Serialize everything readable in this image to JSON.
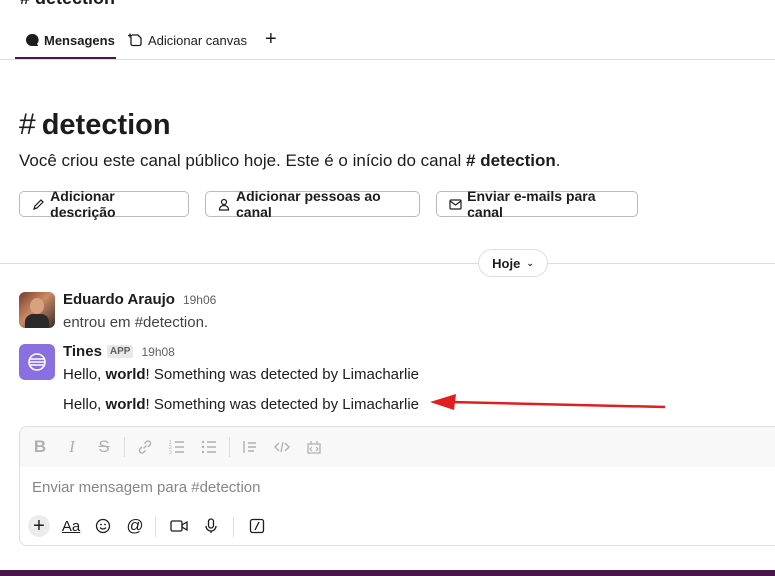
{
  "header": {
    "title": "# detection"
  },
  "tabs": [
    {
      "label": "Mensagens",
      "icon": "message-icon"
    },
    {
      "label": "Adicionar canvas",
      "icon": "canvas-add-icon"
    }
  ],
  "add_tab_icon": "plus-icon",
  "intro": {
    "hash": "#",
    "channel_name": "detection",
    "text_before": "Você criou este canal público hoje. Este é o início do canal ",
    "channel_bold": "# detection",
    "text_after": "."
  },
  "actions": [
    {
      "label": "Adicionar descrição",
      "icon": "pencil-icon"
    },
    {
      "label": "Adicionar pessoas ao canal",
      "icon": "person-add-icon"
    },
    {
      "label": "Enviar e-mails para canal",
      "icon": "email-icon"
    }
  ],
  "day_divider": {
    "label": "Hoje",
    "icon": "chevron-down-icon"
  },
  "messages": [
    {
      "author": "Eduardo Araujo",
      "time": "19h06",
      "text": "entrou em #detection."
    },
    {
      "author": "Tines",
      "badge": "APP",
      "time": "19h08",
      "lines": [
        {
          "before": "Hello, ",
          "bold": "world",
          "after": "! Something was detected by Limacharlie"
        },
        {
          "before": "Hello, ",
          "bold": "world",
          "after": "! Something was detected by Limacharlie"
        }
      ]
    }
  ],
  "annotation": {
    "color": "#e01e1e"
  },
  "composer": {
    "placeholder": "Enviar mensagem para #detection",
    "format_icons": [
      "bold-icon",
      "italic-icon",
      "strikethrough-icon",
      "link-icon",
      "ordered-list-icon",
      "bullet-list-icon",
      "blockquote-icon",
      "code-icon",
      "code-block-icon"
    ],
    "bottom_icons": [
      "plus-icon",
      "text-format-icon",
      "emoji-icon",
      "mention-icon",
      "video-icon",
      "microphone-icon",
      "slash-command-icon"
    ],
    "format_label": "Aa"
  },
  "colors": {
    "accent": "#4a154b",
    "app_avatar": "#8a6fe0"
  }
}
